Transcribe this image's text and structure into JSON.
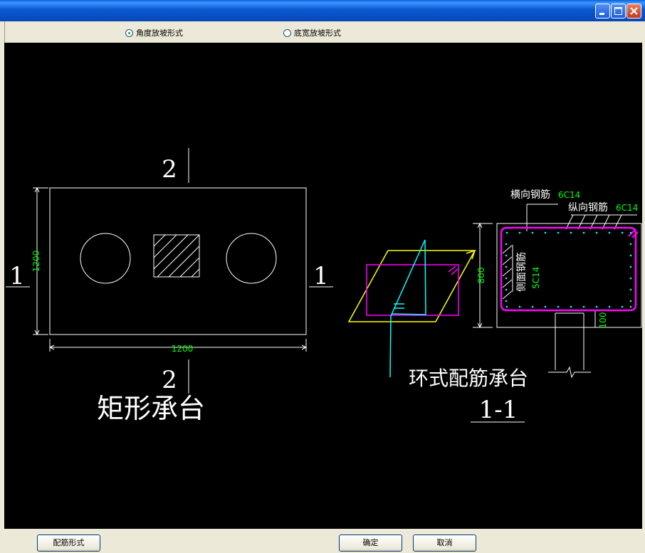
{
  "options": {
    "angle_slope_label": "角度放坡形式",
    "bottom_width_slope_label": "底宽放坡形式",
    "selected": "角度放坡形式"
  },
  "drawing": {
    "rect_cap": {
      "title": "矩形承台",
      "section_2_top": "2",
      "section_2_bottom": "2",
      "section_1_left": "1",
      "section_1_right": "1",
      "dim_height": "1200",
      "dim_width": "1200"
    },
    "ring_cap": {
      "title": "环式配筋承台"
    },
    "section": {
      "title": "1-1",
      "transverse_label": "横向钢筋",
      "transverse_value": "6C14",
      "longitudinal_label": "纵向钢筋",
      "longitudinal_value": "6C14",
      "side_label": "侧面钢筋",
      "side_value": "5C14",
      "dim_height": "800",
      "dim_cover": "100"
    },
    "colors": {
      "background": "#000000",
      "line": "#ffffff",
      "dimension": "#00ff00",
      "rebar": "#ff00ff",
      "cyan": "#00ffff",
      "yellow": "#ffff00"
    }
  },
  "buttons": {
    "rebar_form": "配筋形式",
    "ok": "确定",
    "cancel": "取消"
  }
}
